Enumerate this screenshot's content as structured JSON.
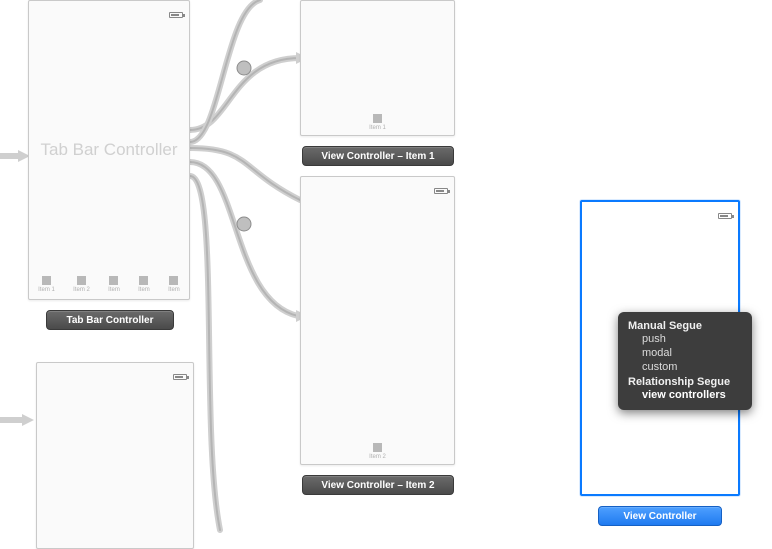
{
  "tabBarController": {
    "placeholderTitle": "Tab Bar Controller",
    "items": [
      {
        "label": "Item 1"
      },
      {
        "label": "Item 2"
      },
      {
        "label": "Item"
      },
      {
        "label": "Item"
      },
      {
        "label": "Item"
      }
    ],
    "title": "Tab Bar Controller"
  },
  "vc1": {
    "title": "View Controller – Item 1",
    "tabLabel": "Item 1"
  },
  "vc2": {
    "title": "View Controller – Item 2",
    "tabLabel": "Item 2"
  },
  "vcSelected": {
    "title": "View Controller"
  },
  "seguePopover": {
    "manualHeader": "Manual Segue",
    "options": {
      "push": "push",
      "modal": "modal",
      "custom": "custom"
    },
    "relationshipHeader": "Relationship Segue",
    "relationshipOption": "view controllers"
  }
}
